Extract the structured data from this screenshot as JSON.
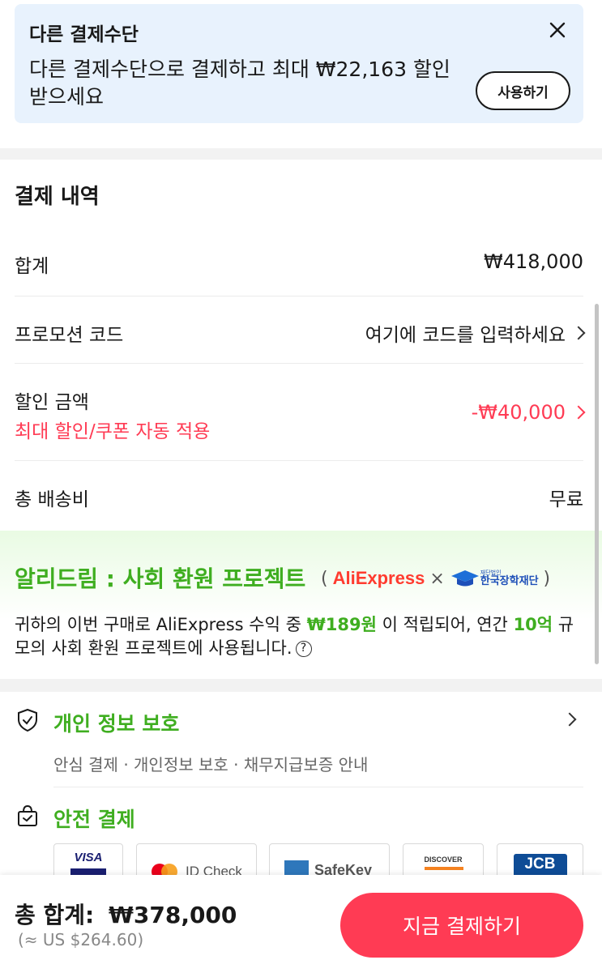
{
  "banner": {
    "title": "다른 결제수단",
    "text": "다른 결제수단으로 결제하고 최대 ₩22,163 할인받으세요",
    "button": "사용하기"
  },
  "summary": {
    "title": "결제 내역",
    "subtotal_label": "합계",
    "subtotal_value": "₩418,000",
    "promo_label": "프로모션 코드",
    "promo_placeholder": "여기에 코드를 입력하세요",
    "discount_label": "할인 금액",
    "discount_note": "최대 할인/쿠폰 자동 적용",
    "discount_value": "-₩40,000",
    "shipping_label": "총 배송비",
    "shipping_value": "무료"
  },
  "dream": {
    "title": "알리드림 : 사회 환원 프로젝트",
    "open_paren": "(",
    "ali_logo": "AliExpress",
    "times": "×",
    "kosaf_small": "재단법인",
    "kosaf_name": "한국장학재단",
    "close_paren": ")",
    "desc_1": "귀하의 이번 구매로 AliExpress 수익 중 ",
    "desc_amount": "₩189원",
    "desc_2": " 이 적립되어, 연간 ",
    "desc_scale": "10억",
    "desc_3": " 규모의 사회 환원 프로젝트에 사용됩니다.",
    "help": "?"
  },
  "privacy": {
    "title": "개인 정보 보호",
    "subtitle": "안심 결제 · 개인정보 보호 · 채무지급보증 안내"
  },
  "safe": {
    "title": "안전 결제",
    "cards": [
      "VISA",
      "ID Check",
      "SafeKey",
      "DISCOVER",
      "JCB"
    ]
  },
  "bottom": {
    "total_label": "총 합계:",
    "total_value": "₩378,000",
    "usd": "(≈ US $264.60)",
    "pay_button": "지금 결제하기"
  },
  "colors": {
    "accent_red": "#ff3b54",
    "accent_green": "#3fae20",
    "banner_bg": "#e8f2fd"
  }
}
